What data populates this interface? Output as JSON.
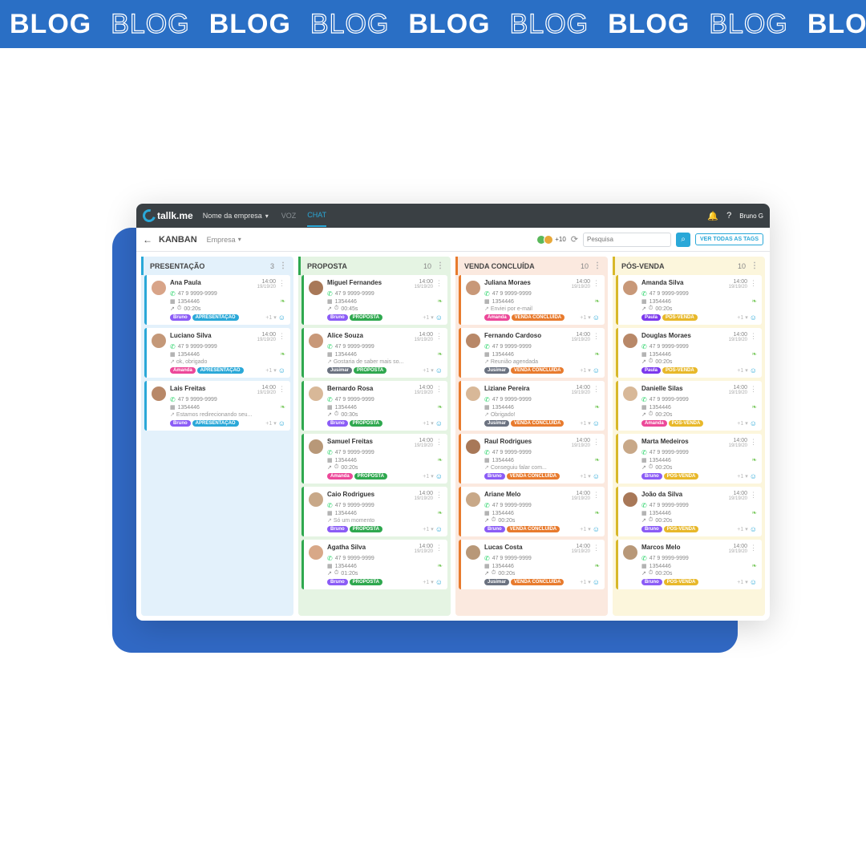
{
  "banner": {
    "word": "BLOG"
  },
  "topbar": {
    "logo": "tallk.me",
    "company": "Nome da empresa",
    "nav_voz": "VOZ",
    "nav_chat": "CHAT",
    "user": "Bruno G"
  },
  "subbar": {
    "title": "KANBAN",
    "company": "Empresa",
    "plus_count": "+10",
    "search_placeholder": "Pesquisa",
    "tags_btn": "VER TODAS AS TAGS"
  },
  "columns": [
    {
      "title": "PRESENTAÇÃO",
      "count": "3",
      "theme": "blue",
      "cards": [
        {
          "name": "Ana Paula",
          "time": "14:00",
          "date": "19/19/20",
          "phone": "47 9 9999-9999",
          "protocol": "1354446",
          "extra": "00:20s",
          "msg": "",
          "agent": "Bruno",
          "agent_cls": "bruno",
          "stage": "APRESENTAÇÃO",
          "stage_cls": "apr",
          "av": "#d8a488"
        },
        {
          "name": "Luciano Silva",
          "time": "14:00",
          "date": "19/19/20",
          "phone": "47 9 9999-9999",
          "protocol": "1354446",
          "extra": "",
          "msg": "ok, obrigado",
          "agent": "Amanda",
          "agent_cls": "amanda",
          "stage": "APRESENTAÇÃO",
          "stage_cls": "apr",
          "av": "#c49878"
        },
        {
          "name": "Lais Freitas",
          "time": "14:00",
          "date": "19/19/20",
          "phone": "47 9 9999-9999",
          "protocol": "1354446",
          "extra": "",
          "msg": "Estamos redirecionando seu...",
          "agent": "Bruno",
          "agent_cls": "bruno",
          "stage": "APRESENTAÇÃO",
          "stage_cls": "apr",
          "av": "#b88868"
        }
      ]
    },
    {
      "title": "PROPOSTA",
      "count": "10",
      "theme": "green",
      "cards": [
        {
          "name": "Miguel Fernandes",
          "time": "14:00",
          "date": "19/19/20",
          "phone": "47 9 9999-9999",
          "protocol": "1354446",
          "extra": "00:45s",
          "msg": "",
          "agent": "Bruno",
          "agent_cls": "bruno",
          "stage": "PROPOSTA",
          "stage_cls": "prop",
          "av": "#a87858"
        },
        {
          "name": "Alice Souza",
          "time": "14:00",
          "date": "19/19/20",
          "phone": "47 9 9999-9999",
          "protocol": "1354446",
          "extra": "",
          "msg": "Gostaria de saber mais so...",
          "agent": "Jusimar",
          "agent_cls": "jusimar",
          "stage": "PROPOSTA",
          "stage_cls": "prop",
          "av": "#c89878"
        },
        {
          "name": "Bernardo Rosa",
          "time": "14:00",
          "date": "19/19/20",
          "phone": "47 9 9999-9999",
          "protocol": "1354446",
          "extra": "00:30s",
          "msg": "",
          "agent": "Bruno",
          "agent_cls": "bruno",
          "stage": "PROPOSTA",
          "stage_cls": "prop",
          "av": "#d8b898"
        },
        {
          "name": "Samuel Freitas",
          "time": "14:00",
          "date": "19/19/20",
          "phone": "47 9 9999-9999",
          "protocol": "1354446",
          "extra": "00:20s",
          "msg": "",
          "agent": "Amanda",
          "agent_cls": "amanda",
          "stage": "PROPOSTA",
          "stage_cls": "prop",
          "av": "#b89878"
        },
        {
          "name": "Caio Rodrigues",
          "time": "14:00",
          "date": "19/19/20",
          "phone": "47 9 9999-9999",
          "protocol": "1354446",
          "extra": "",
          "msg": "Só um momento",
          "agent": "Bruno",
          "agent_cls": "bruno",
          "stage": "PROPOSTA",
          "stage_cls": "prop",
          "av": "#c8a888"
        },
        {
          "name": "Agatha Silva",
          "time": "14:00",
          "date": "19/19/20",
          "phone": "47 9 9999-9999",
          "protocol": "1354446",
          "extra": "01:20s",
          "msg": "",
          "agent": "Bruno",
          "agent_cls": "bruno",
          "stage": "PROPOSTA",
          "stage_cls": "prop",
          "av": "#d8a888"
        }
      ]
    },
    {
      "title": "VENDA CONCLUÍDA",
      "count": "10",
      "theme": "orange",
      "cards": [
        {
          "name": "Juliana Moraes",
          "time": "14:00",
          "date": "19/19/20",
          "phone": "47 9 9999-9999",
          "protocol": "1354446",
          "extra": "",
          "msg": "Enviei por e-mail",
          "agent": "Amanda",
          "agent_cls": "amanda",
          "stage": "VENDA CONCLUÍDA",
          "stage_cls": "venda",
          "av": "#c89878"
        },
        {
          "name": "Fernando Cardoso",
          "time": "14:00",
          "date": "19/19/20",
          "phone": "47 9 9999-9999",
          "protocol": "1354446",
          "extra": "",
          "msg": "Reunião agendada",
          "agent": "Jusimar",
          "agent_cls": "jusimar",
          "stage": "VENDA CONCLUÍDA",
          "stage_cls": "venda",
          "av": "#b88868"
        },
        {
          "name": "Liziane Pereira",
          "time": "14:00",
          "date": "19/19/20",
          "phone": "47 9 9999-9999",
          "protocol": "1354446",
          "extra": "",
          "msg": "Obrigado!",
          "agent": "Jusimar",
          "agent_cls": "jusimar",
          "stage": "VENDA CONCLUÍDA",
          "stage_cls": "venda",
          "av": "#d8b898"
        },
        {
          "name": "Raul Rodrigues",
          "time": "14:00",
          "date": "19/19/20",
          "phone": "47 9 9999-9999",
          "protocol": "1354446",
          "extra": "",
          "msg": "Conseguiu falar com...",
          "agent": "Bruno",
          "agent_cls": "bruno",
          "stage": "VENDA CONCLUÍDA",
          "stage_cls": "venda",
          "av": "#a87858"
        },
        {
          "name": "Ariane Melo",
          "time": "14:00",
          "date": "19/19/20",
          "phone": "47 9 9999-9999",
          "protocol": "1354446",
          "extra": "00:20s",
          "msg": "",
          "agent": "Bruno",
          "agent_cls": "bruno",
          "stage": "VENDA CONCLUÍDA",
          "stage_cls": "venda",
          "av": "#c8a888"
        },
        {
          "name": "Lucas Costa",
          "time": "14:00",
          "date": "19/19/20",
          "phone": "47 9 9999-9999",
          "protocol": "1354446",
          "extra": "00:20s",
          "msg": "",
          "agent": "Jusimar",
          "agent_cls": "jusimar",
          "stage": "VENDA CONCLUÍDA",
          "stage_cls": "venda",
          "av": "#b89878"
        }
      ]
    },
    {
      "title": "PÓS-VENDA",
      "count": "10",
      "theme": "yellow",
      "cards": [
        {
          "name": "Amanda Silva",
          "time": "14:00",
          "date": "19/19/20",
          "phone": "47 9 9999-9999",
          "protocol": "1354446",
          "extra": "00:20s",
          "msg": "",
          "agent": "Paula",
          "agent_cls": "paula",
          "stage": "PÓS-VENDA",
          "stage_cls": "pos",
          "av": "#c89878"
        },
        {
          "name": "Douglas Moraes",
          "time": "14:00",
          "date": "19/19/20",
          "phone": "47 9 9999-9999",
          "protocol": "1354446",
          "extra": "00:20s",
          "msg": "",
          "agent": "Paula",
          "agent_cls": "paula",
          "stage": "PÓS-VENDA",
          "stage_cls": "pos",
          "av": "#b88868"
        },
        {
          "name": "Danielle Silas",
          "time": "14:00",
          "date": "19/19/20",
          "phone": "47 9 9999-9999",
          "protocol": "1354446",
          "extra": "00:20s",
          "msg": "",
          "agent": "Amanda",
          "agent_cls": "amanda",
          "stage": "PÓS-VENDA",
          "stage_cls": "pos",
          "av": "#d8b898"
        },
        {
          "name": "Marta Medeiros",
          "time": "14:00",
          "date": "19/19/20",
          "phone": "47 9 9999-9999",
          "protocol": "1354446",
          "extra": "00:20s",
          "msg": "",
          "agent": "Bruno",
          "agent_cls": "bruno",
          "stage": "PÓS-VENDA",
          "stage_cls": "pos",
          "av": "#c8a888"
        },
        {
          "name": "João da Silva",
          "time": "14:00",
          "date": "19/19/20",
          "phone": "47 9 9999-9999",
          "protocol": "1354446",
          "extra": "00:20s",
          "msg": "",
          "agent": "Bruno",
          "agent_cls": "bruno",
          "stage": "PÓS-VENDA",
          "stage_cls": "pos",
          "av": "#a87858"
        },
        {
          "name": "Marcos Melo",
          "time": "14:00",
          "date": "19/19/20",
          "phone": "47 9 9999-9999",
          "protocol": "1354446",
          "extra": "00:20s",
          "msg": "",
          "agent": "Bruno",
          "agent_cls": "bruno",
          "stage": "PÓS-VENDA",
          "stage_cls": "pos",
          "av": "#b89878"
        }
      ]
    }
  ]
}
